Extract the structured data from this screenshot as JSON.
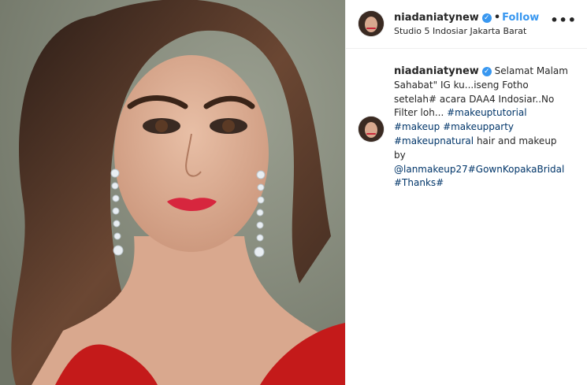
{
  "post": {
    "image_alt": "Portrait photo with glam makeup, drop crystal earrings and red lace dress",
    "header": {
      "username": "niadaniatynew",
      "verified_icon": "verified-badge-icon",
      "separator": "•",
      "follow_label": "Follow",
      "location": "Studio 5 Indosiar Jakarta Barat",
      "more_icon": "more-options-icon",
      "more_label": "•••"
    },
    "caption": {
      "username": "niadaniatynew",
      "text_1": " Selamat Malam Sahabat\" IG ku...iseng Fotho setelah# acara DAA4 Indosiar..No Filter loh... ",
      "tag_1": "#makeuptutorial",
      "tag_2": "#makeup",
      "tag_3": "#makeupparty",
      "tag_4": "#makeupnatural",
      "text_2": " hair and makeup by ",
      "mention_1": "@lanmakeup27",
      "tag_5": "#GownKopakaBridal",
      "tag_6": "#Thanks",
      "tag_7": "#"
    },
    "colors": {
      "accent": "#3897f0",
      "link": "#003569",
      "text": "#262626",
      "border": "#efefef"
    }
  }
}
